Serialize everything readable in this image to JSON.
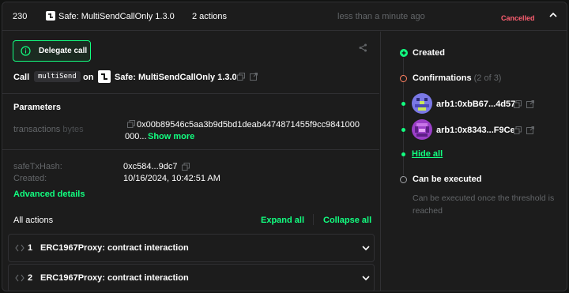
{
  "tx": {
    "nonce": "230",
    "contract_name": "Safe: MultiSendCallOnly 1.3.0",
    "actions_count": "2 actions",
    "time": "less than a minute ago",
    "status": "Cancelled"
  },
  "left": {
    "delegate_label": "Delegate call",
    "call_word": "Call",
    "method": "multiSend",
    "on_word": "on",
    "contract": "Safe: MultiSendCallOnly 1.3.0",
    "parameters_title": "Parameters",
    "param_name": "transactions",
    "param_type": "bytes",
    "param_value_line1": "0x00b89546c5aa3b9d5bd1deab4474871455f9cc9841000",
    "param_value_line2": "000...",
    "show_more": "Show more",
    "safe_tx_hash_label": "safeTxHash:",
    "safe_tx_hash": "0xc584...9dc7",
    "created_label": "Created:",
    "created_value": "10/16/2024, 10:42:51 AM",
    "advanced_details": "Advanced details",
    "all_actions": "All actions",
    "expand_all": "Expand all",
    "collapse_all": "Collapse all",
    "actions": [
      {
        "index": "1",
        "title": "ERC1967Proxy: contract interaction"
      },
      {
        "index": "2",
        "title": "ERC1967Proxy: contract interaction"
      }
    ]
  },
  "right": {
    "created": "Created",
    "confirmations": "Confirmations",
    "confirmations_count": "(2 of 3)",
    "signers": [
      {
        "prefix": "arb1:",
        "address": "0xbB67...4d57"
      },
      {
        "prefix": "arb1:",
        "address": "0x8343...F9Ce"
      }
    ],
    "hide_all": "Hide all",
    "can_be_executed": "Can be executed",
    "exec_note": "Can be executed once the threshold is reached"
  },
  "colors": {
    "accent_green": "#12ff80",
    "cancelled_red": "#ff5f72",
    "confirm_orange": "#ff8061",
    "muted": "#636669"
  }
}
